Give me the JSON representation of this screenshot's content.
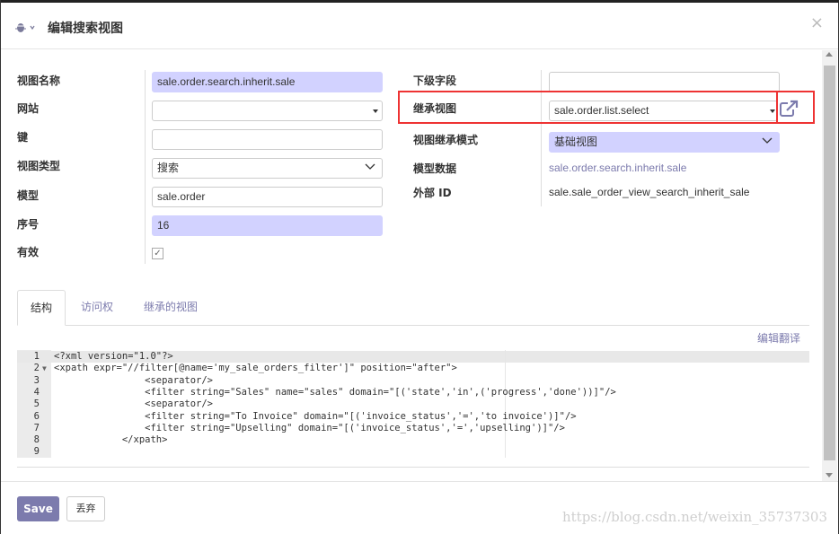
{
  "dialog": {
    "title": "编辑搜索视图",
    "close": "×"
  },
  "left_fields": [
    {
      "label": "视图名称",
      "value": "sale.order.search.inherit.sale"
    },
    {
      "label": "网站",
      "value": ""
    },
    {
      "label": "键",
      "value": ""
    },
    {
      "label": "视图类型",
      "value": "搜索"
    },
    {
      "label": "模型",
      "value": "sale.order"
    },
    {
      "label": "序号",
      "value": "16"
    },
    {
      "label": "有效",
      "value": "✓"
    }
  ],
  "right_fields": [
    {
      "label": "下级字段",
      "value": ""
    },
    {
      "label": "继承视图",
      "value": "sale.order.list.select"
    },
    {
      "label": "视图继承模式",
      "value": "基础视图"
    },
    {
      "label": "模型数据",
      "value": "sale.order.search.inherit.sale"
    },
    {
      "label": "外部 ID",
      "value": "sale.sale_order_view_search_inherit_sale"
    }
  ],
  "tabs": [
    {
      "label": "结构"
    },
    {
      "label": "访问权"
    },
    {
      "label": "继承的视图"
    }
  ],
  "edit_translation": "编辑翻译",
  "code_lines": [
    {
      "num": "1",
      "fold": "",
      "text": "<?xml version=\"1.0\"?>"
    },
    {
      "num": "2",
      "fold": "▼",
      "text": "<xpath expr=\"//filter[@name='my_sale_orders_filter']\" position=\"after\">"
    },
    {
      "num": "3",
      "fold": "",
      "text": "                <separator/>"
    },
    {
      "num": "4",
      "fold": "",
      "text": "                <filter string=\"Sales\" name=\"sales\" domain=\"[('state','in',('progress','done'))]\"/>"
    },
    {
      "num": "5",
      "fold": "",
      "text": "                <separator/>"
    },
    {
      "num": "6",
      "fold": "",
      "text": "                <filter string=\"To Invoice\" domain=\"[('invoice_status','=','to invoice')]\"/>"
    },
    {
      "num": "7",
      "fold": "",
      "text": "                <filter string=\"Upselling\" domain=\"[('invoice_status','=','upselling')]\"/>"
    },
    {
      "num": "8",
      "fold": "",
      "text": "            </xpath>"
    },
    {
      "num": "9",
      "fold": "",
      "text": ""
    }
  ],
  "footer": {
    "save": "Save",
    "discard": "丢弃"
  },
  "watermark": "https://blog.csdn.net/weixin_35737303",
  "colors": {
    "accent": "#7c7bad",
    "required_bg": "#d2d2ff",
    "highlight": "#ee3333"
  },
  "icons": {
    "bug": "bug-icon",
    "external": "external-link-icon",
    "close": "close-icon"
  }
}
